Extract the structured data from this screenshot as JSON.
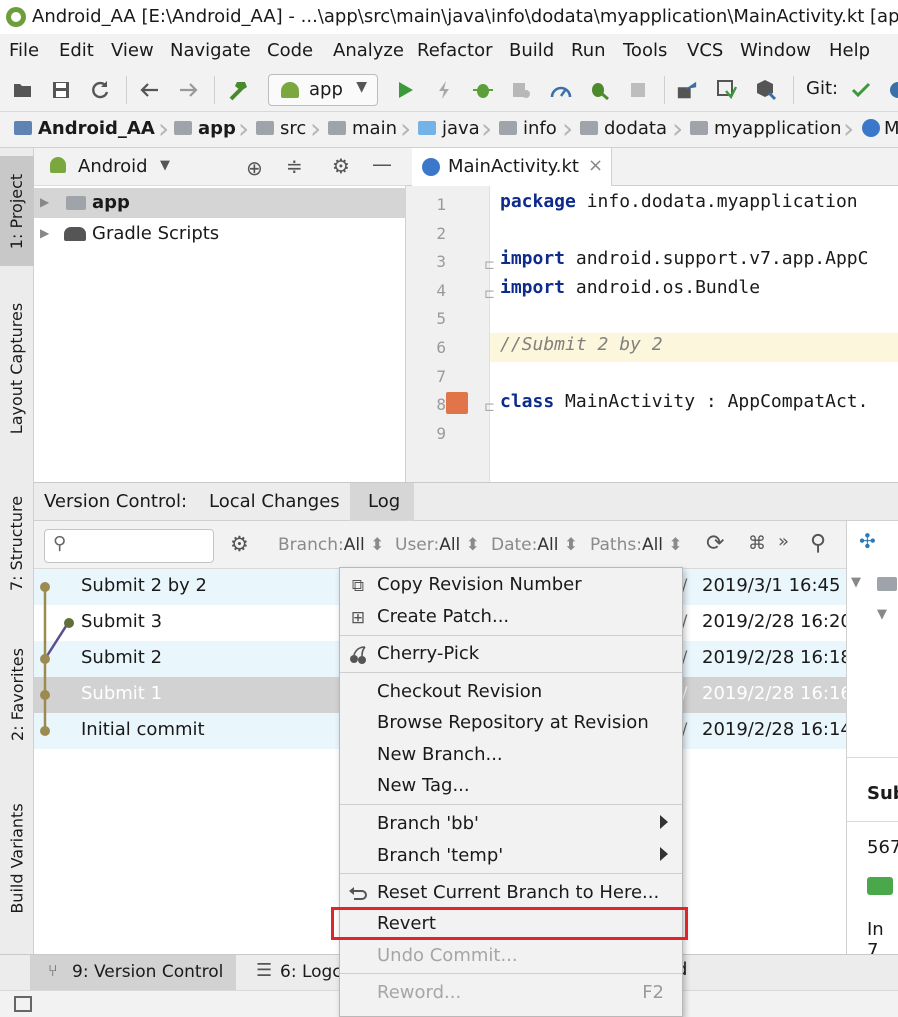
{
  "window": {
    "title": "Android_AA [E:\\Android_AA] - ...\\app\\src\\main\\java\\info\\dodata\\myapplication\\MainActivity.kt [app]"
  },
  "menu": [
    "File",
    "Edit",
    "View",
    "Navigate",
    "Code",
    "Analyze",
    "Refactor",
    "Build",
    "Run",
    "Tools",
    "VCS",
    "Window",
    "Help"
  ],
  "toolbar": {
    "run_config": "app",
    "git_label": "Git:",
    "icons": [
      "open-folder-icon",
      "save-icon",
      "sync-icon",
      "back-icon",
      "forward-icon",
      "build-hammer-icon",
      "run-icon",
      "apply-changes-icon",
      "debug-icon",
      "attach-debugger-icon",
      "profile-icon",
      "debug-bug-icon",
      "stop-icon",
      "avd-manager-icon",
      "sdk-manager-icon",
      "project-structure-icon",
      "git-commit-check-icon"
    ]
  },
  "breadcrumb": [
    "Android_AA",
    "app",
    "src",
    "main",
    "java",
    "info",
    "dodata",
    "myapplication",
    "M"
  ],
  "sidebar_left": {
    "tabs": [
      "1: Project",
      "Layout Captures",
      "7: Structure",
      "2: Favorites",
      "Build Variants"
    ]
  },
  "project": {
    "view_mode": "Android",
    "tree": [
      {
        "label": "app",
        "selected": true
      },
      {
        "label": "Gradle Scripts",
        "selected": false
      }
    ]
  },
  "editor": {
    "tab_label": "MainActivity.kt",
    "close_glyph": "×",
    "lines": [
      {
        "num": "1",
        "parts": [
          {
            "t": "package",
            "c": "kw"
          },
          {
            "t": " info.dodata.myapplication",
            "c": ""
          }
        ]
      },
      {
        "num": "2",
        "parts": []
      },
      {
        "num": "3",
        "parts": [
          {
            "t": "import",
            "c": "kw"
          },
          {
            "t": " android.support.v7.app.AppC",
            "c": ""
          }
        ]
      },
      {
        "num": "4",
        "parts": [
          {
            "t": "import",
            "c": "kw"
          },
          {
            "t": " android.os.Bundle",
            "c": ""
          }
        ]
      },
      {
        "num": "5",
        "parts": []
      },
      {
        "num": "6",
        "parts": [
          {
            "t": "//Submit 2 by 2",
            "c": "cm"
          }
        ]
      },
      {
        "num": "7",
        "parts": []
      },
      {
        "num": "8",
        "parts": [
          {
            "t": "class",
            "c": "kw"
          },
          {
            "t": " MainActivity : AppCompatAct.",
            "c": ""
          }
        ]
      },
      {
        "num": "9",
        "parts": []
      }
    ]
  },
  "version_control": {
    "title": "Version Control:",
    "tabs": [
      "Local Changes",
      "Log"
    ],
    "active_tab": "Log",
    "filters": [
      {
        "label": "Branch:",
        "value": "All"
      },
      {
        "label": "User:",
        "value": "All"
      },
      {
        "label": "Date:",
        "value": "All"
      },
      {
        "label": "Paths:",
        "value": "All"
      }
    ],
    "more_glyph": "»",
    "commits": [
      {
        "message": "Submit 2 by 2",
        "date": "2019/3/1 16:45"
      },
      {
        "message": "Submit 3",
        "date": "2019/2/28 16:20"
      },
      {
        "message": "Submit 2",
        "date": "2019/2/28 16:18"
      },
      {
        "message": "Submit 1",
        "date": "2019/2/28 16:16"
      },
      {
        "message": "Initial commit",
        "date": "2019/2/28 16:14"
      }
    ],
    "right_pane": {
      "heading": "Sub",
      "line1": "567",
      "line2": "In 7"
    }
  },
  "bottom_tabs": [
    {
      "label": "9: Version Control"
    },
    {
      "label": "6: Logc"
    }
  ],
  "context_menu": {
    "items": [
      {
        "label": "Copy Revision Number",
        "icon": "copy-icon"
      },
      {
        "label": "Create Patch...",
        "icon": "patch-icon"
      },
      {
        "label": "Cherry-Pick",
        "icon": "cherry-pick-icon"
      },
      {
        "label": "Checkout Revision"
      },
      {
        "label": "Browse Repository at Revision"
      },
      {
        "label": "New Branch..."
      },
      {
        "label": "New Tag..."
      },
      {
        "label": "Branch 'bb'"
      },
      {
        "label": "Branch 'temp'"
      },
      {
        "label": "Reset Current Branch to Here...",
        "icon": "reset-icon"
      },
      {
        "label": "Revert"
      },
      {
        "label": "Undo Commit..."
      },
      {
        "label": "Reword...",
        "shortcut": "F2"
      }
    ]
  },
  "colors": {
    "highlight_box": "#e0242b",
    "graph_line": "#9b8b50",
    "graph_branch": "#5f6f3a",
    "row_alt": "#e9f7fd"
  }
}
